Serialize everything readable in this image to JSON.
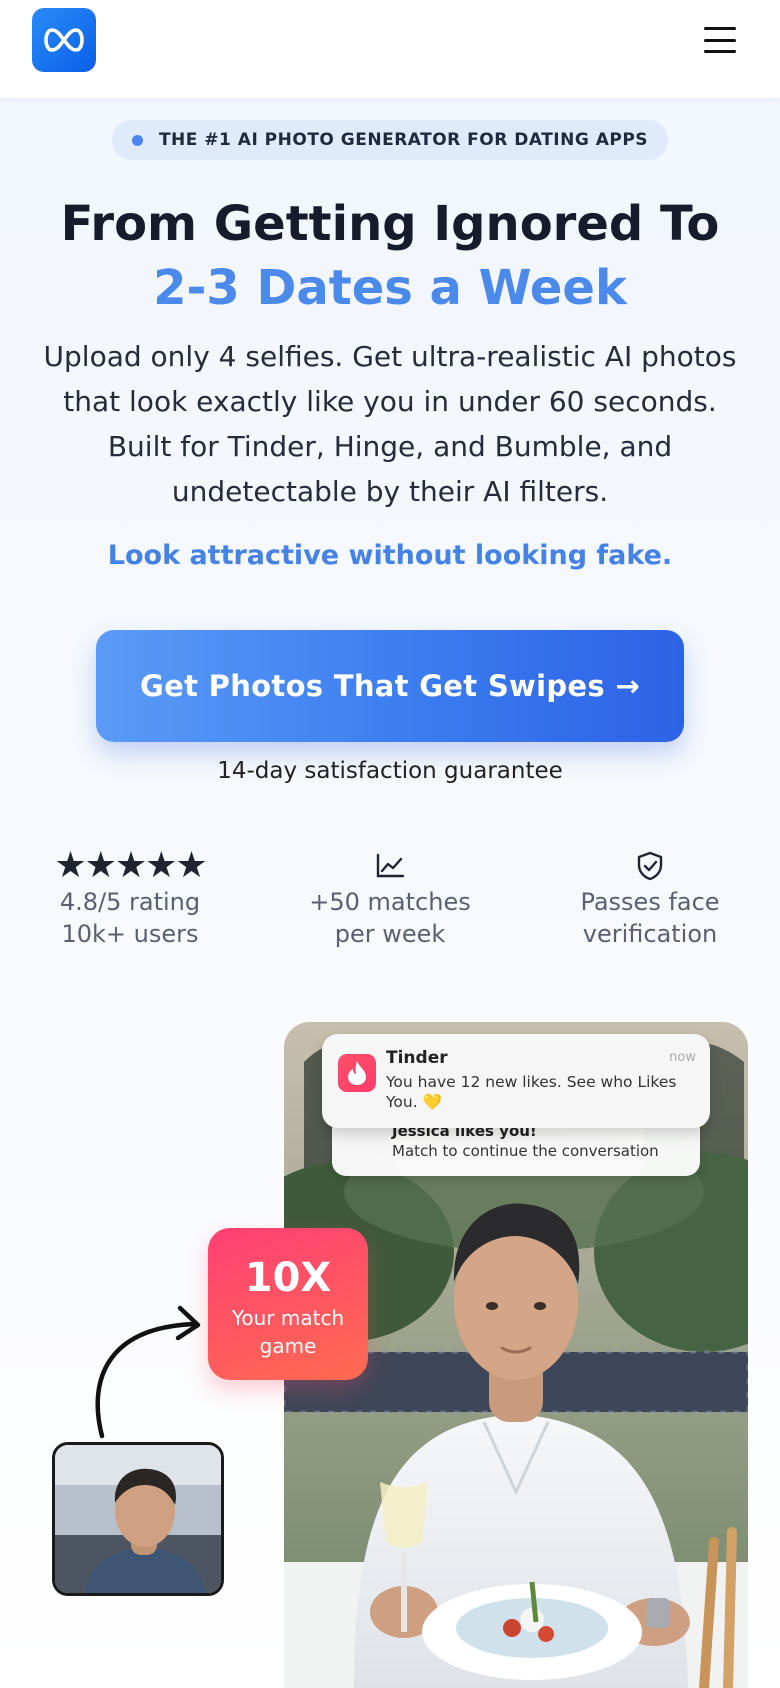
{
  "header": {
    "logo_icon": "infinity-icon",
    "menu_icon": "hamburger-menu-icon"
  },
  "hero": {
    "badge": "THE #1 AI PHOTO GENERATOR FOR DATING APPS",
    "headline_line1": "From Getting Ignored To",
    "headline_line2": "2-3 Dates a Week",
    "subtext": "Upload only 4 selfies. Get ultra-realistic AI photos that look exactly like you in under 60 seconds. Built for Tinder, Hinge, and Bumble, and undetectable by their AI filters.",
    "tagline": "Look attractive without looking fake.",
    "cta_label": "Get Photos That Get Swipes →",
    "guarantee": "14-day satisfaction guarantee"
  },
  "stats": [
    {
      "icon": "five-stars-icon",
      "line1": "4.8/5 rating",
      "line2": "10k+ users"
    },
    {
      "icon": "trending-chart-icon",
      "line1": "+50 matches",
      "line2": "per week"
    },
    {
      "icon": "shield-check-icon",
      "line1": "Passes face",
      "line2": "verification"
    }
  ],
  "showcase": {
    "notification": {
      "app": "Tinder",
      "time": "now",
      "text": "You have 12 new likes. See who Likes You. 💛"
    },
    "notification_back": {
      "title": "Jessica likes you!",
      "text": "Match to continue the conversation"
    },
    "multiplier": {
      "big": "10X",
      "small": "Your match game"
    }
  },
  "colors": {
    "accent": "#4b89ea",
    "cta_start": "#5a9bf6",
    "cta_end": "#2d62e6",
    "badge_bg": "#dfeafb",
    "pink": "#ff3f74"
  }
}
